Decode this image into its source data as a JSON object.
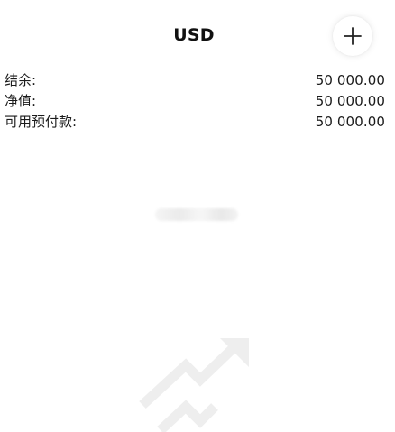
{
  "header": {
    "title": "USD",
    "add_icon": "plus-icon"
  },
  "summary": {
    "rows": [
      {
        "label": "结余:",
        "value": "50 000.00"
      },
      {
        "label": "净值:",
        "value": "50 000.00"
      },
      {
        "label": "可用预付款:",
        "value": "50 000.00"
      }
    ]
  },
  "empty_state": {
    "icon": "trending-up-chart-icon"
  }
}
